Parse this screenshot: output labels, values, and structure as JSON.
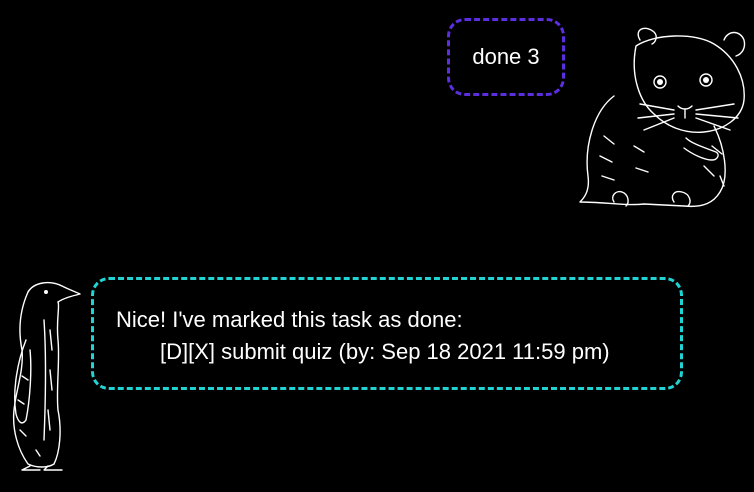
{
  "chat": {
    "user_message": "done 3",
    "bot_line1": "Nice! I've marked this task as done:",
    "bot_line2": "[D][X] submit quiz (by: Sep 18 2021 11:59 pm)"
  },
  "avatars": {
    "user_icon": "hamster-icon",
    "bot_icon": "penguin-icon"
  },
  "colors": {
    "background": "#000000",
    "text": "#ffffff",
    "user_bubble_border": "#5b2fe0",
    "bot_bubble_border": "#22d3d3"
  }
}
